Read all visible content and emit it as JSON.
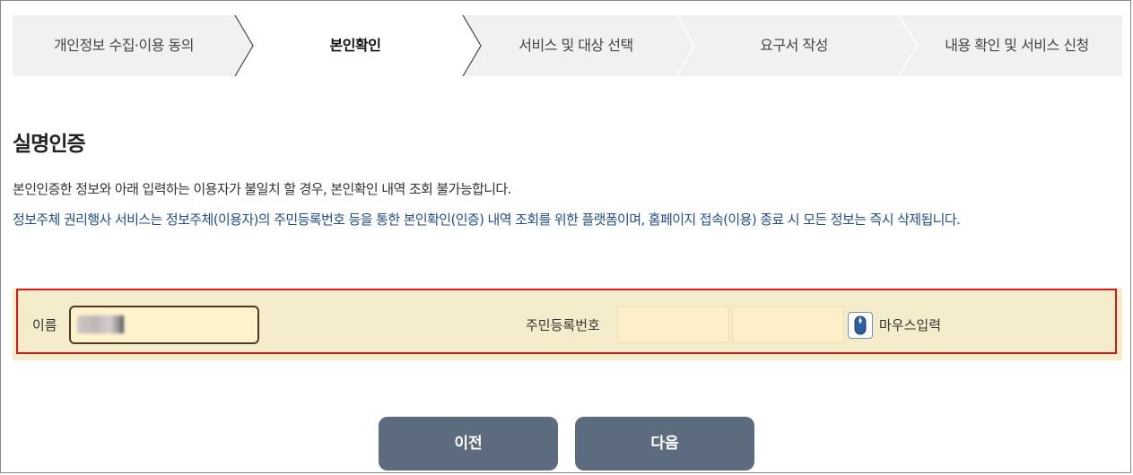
{
  "steps": [
    {
      "label": "개인정보 수집·이용 동의",
      "active": false
    },
    {
      "label": "본인확인",
      "active": true
    },
    {
      "label": "서비스 및 대상 선택",
      "active": false
    },
    {
      "label": "요구서 작성",
      "active": false
    },
    {
      "label": "내용 확인 및 서비스 신청",
      "active": false
    }
  ],
  "section": {
    "title": "실명인증",
    "notice": "본인인증한 정보와 아래 입력하는 이용자가 불일치 할 경우, 본인확인 내역 조회 불가능합니다.",
    "info": "정보주체 권리행사 서비스는 정보주체(이용자)의 주민등록번호 등을 통한 본인확인(인증) 내역 조회를 위한 플랫폼이며, 홈페이지 접속(이용) 종료 시 모든 정보는 즉시 삭제됩니다."
  },
  "form": {
    "name_label": "이름",
    "rrn_label": "주민등록번호",
    "mouse_input_label": "마우스입력",
    "mouse_icon": "mouse-icon"
  },
  "buttons": {
    "prev": "이전",
    "next": "다음"
  },
  "colors": {
    "form_bg": "#f4ecca",
    "highlight_border": "#d61a1a",
    "button_bg": "#5d6b7e",
    "info_text": "#1f4e8c"
  }
}
